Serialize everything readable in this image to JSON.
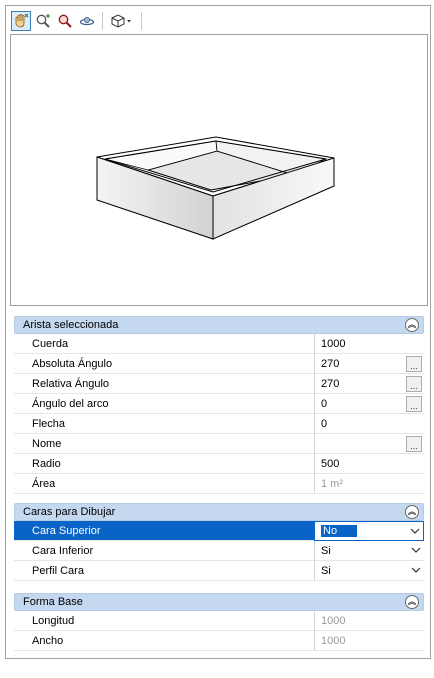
{
  "toolbar": {
    "buttons": [
      {
        "icon": "pan-hand-icon",
        "active": true
      },
      {
        "icon": "zoom-extents-icon",
        "active": false
      },
      {
        "icon": "zoom-icon",
        "active": false
      },
      {
        "icon": "orbit-icon",
        "active": false
      },
      {
        "icon": "view-cube-dropdown-icon",
        "active": false
      }
    ]
  },
  "sections": {
    "arista": {
      "title": "Arista seleccionada",
      "rows": {
        "cuerda": {
          "label": "Cuerda",
          "value": "1000"
        },
        "absoluta": {
          "label": "Absoluta Ángulo",
          "value": "270"
        },
        "relativa": {
          "label": "Relativa Ángulo",
          "value": "270"
        },
        "angulo_arco": {
          "label": "Ángulo del arco",
          "value": "0"
        },
        "flecha": {
          "label": "Flecha",
          "value": "0"
        },
        "nome": {
          "label": "Nome",
          "value": ""
        },
        "radio": {
          "label": "Radio",
          "value": "500"
        },
        "area": {
          "label": "Área",
          "value": "1 m²"
        }
      }
    },
    "caras": {
      "title": "Caras para Dibujar",
      "rows": {
        "superior": {
          "label": "Cara Superior",
          "value": "No"
        },
        "inferior": {
          "label": "Cara Inferior",
          "value": "Si"
        },
        "perfil": {
          "label": "Perfil Cara",
          "value": "Si"
        }
      }
    },
    "forma": {
      "title": "Forma Base",
      "rows": {
        "longitud": {
          "label": "Longitud",
          "value": "1000"
        },
        "ancho": {
          "label": "Ancho",
          "value": "1000"
        }
      }
    }
  },
  "colors": {
    "section_header": "#c4d8ef",
    "selection": "#0a64c8",
    "readonly_text": "#9a9a9a"
  }
}
